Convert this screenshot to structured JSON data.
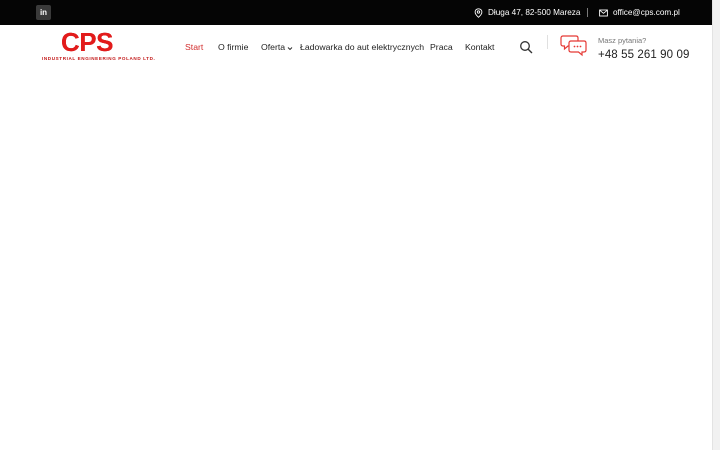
{
  "topbar": {
    "social": {
      "linkedin_label": "in",
      "icon": "linkedin-icon"
    },
    "address": {
      "text": "Długa 47, 82-500 Mareza",
      "icon": "map-pin-icon"
    },
    "email": {
      "text": "office@cps.com.pl",
      "icon": "mail-icon"
    }
  },
  "logo": {
    "title": "CPS",
    "subtitle": "INDUSTRIAL ENGINEERING POLAND LTD.",
    "color": "#e31b1b"
  },
  "nav": {
    "items": [
      {
        "label": "Start",
        "active": true
      },
      {
        "label": "O firmie",
        "active": false
      },
      {
        "label": "Oferta",
        "active": false,
        "has_dropdown": true
      },
      {
        "label": "Ładowarka do aut elektrycznych",
        "active": false
      },
      {
        "label": "Praca",
        "active": false
      },
      {
        "label": "Kontakt",
        "active": false
      }
    ],
    "active_color": "#d32f2f"
  },
  "header_contact": {
    "question": "Masz pytania?",
    "phone": "+48 55 261 90 09",
    "icon": "chat-icon",
    "icon_color": "#e53935"
  },
  "search": {
    "icon": "search-icon"
  }
}
